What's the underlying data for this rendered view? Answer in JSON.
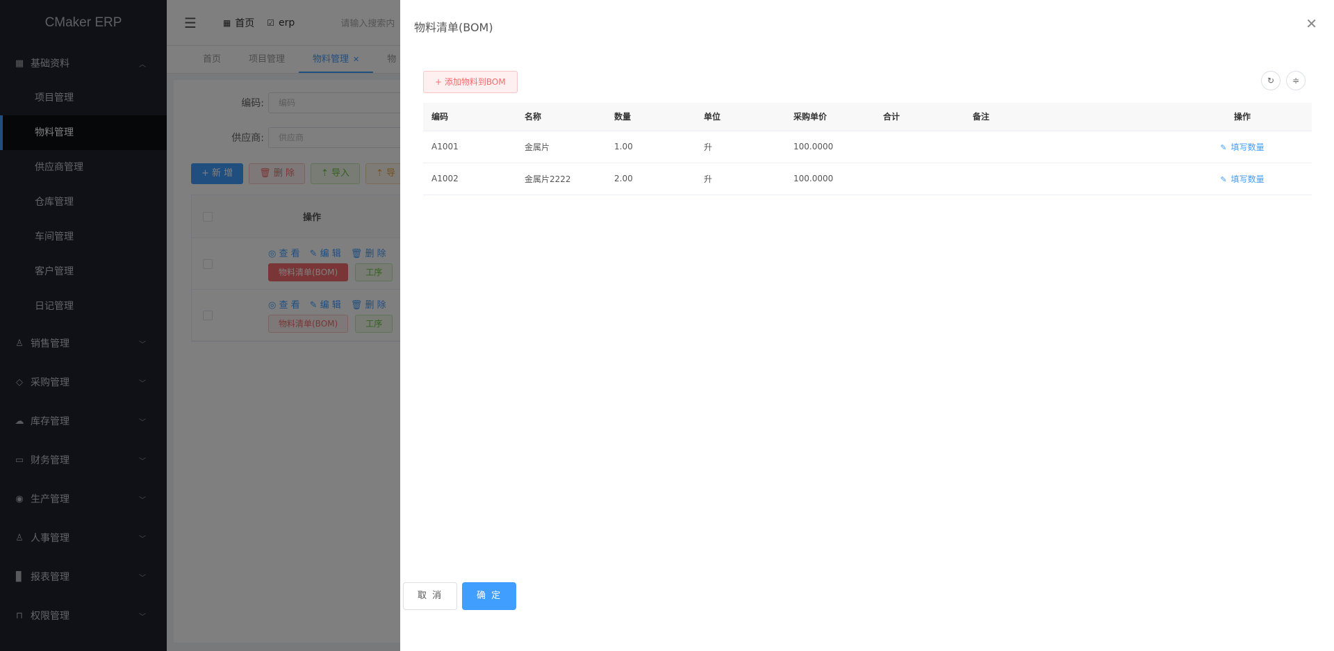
{
  "app": {
    "title": "CMaker ERP"
  },
  "sidebar": {
    "groups": [
      {
        "label": "基础资料",
        "icon": "grid-icon",
        "expanded": true,
        "items": [
          {
            "label": "项目管理"
          },
          {
            "label": "物料管理",
            "active": true
          },
          {
            "label": "供应商管理"
          },
          {
            "label": "仓库管理"
          },
          {
            "label": "车间管理"
          },
          {
            "label": "客户管理"
          },
          {
            "label": "日记管理"
          }
        ]
      },
      {
        "label": "销售管理",
        "icon": "user-icon"
      },
      {
        "label": "采购管理",
        "icon": "tag-icon"
      },
      {
        "label": "库存管理",
        "icon": "cloud-icon"
      },
      {
        "label": "财务管理",
        "icon": "wallet-icon"
      },
      {
        "label": "生产管理",
        "icon": "location-icon"
      },
      {
        "label": "人事管理",
        "icon": "person-icon"
      },
      {
        "label": "报表管理",
        "icon": "bar-chart-icon"
      },
      {
        "label": "权限管理",
        "icon": "lock-icon"
      }
    ]
  },
  "navbar": {
    "breadcrumbs": [
      {
        "label": "首页",
        "icon": "grid-icon"
      },
      {
        "label": "erp",
        "icon": "check-square-icon"
      }
    ],
    "search_placeholder": "请输入搜索内"
  },
  "tabs": [
    {
      "label": "首页"
    },
    {
      "label": "项目管理"
    },
    {
      "label": "物料管理",
      "active": true
    },
    {
      "label": "物"
    }
  ],
  "filter": {
    "code_label": "编码:",
    "code_placeholder": "编码",
    "supplier_label": "供应商:",
    "supplier_placeholder": "供应商"
  },
  "toolbar": {
    "add": "+ 新 增",
    "delete": "删 除",
    "import": "导入",
    "export": "导"
  },
  "grid": {
    "op_header": "操作",
    "links": {
      "view": "查 看",
      "edit": "编 辑",
      "delete": "删 除"
    },
    "bom_button": "物料清单(BOM)",
    "step_button": "工序"
  },
  "drawer": {
    "title": "物料清单(BOM)",
    "add_button": "添加物料到BOM",
    "columns": [
      "编码",
      "名称",
      "数量",
      "单位",
      "采购单价",
      "合计",
      "备注",
      "操作"
    ],
    "rows": [
      {
        "code": "A1001",
        "name": "金属片",
        "qty": "1.00",
        "unit": "升",
        "price": "100.0000",
        "total": "",
        "note": "",
        "action": "填写数量"
      },
      {
        "code": "A1002",
        "name": "金属片2222",
        "qty": "2.00",
        "unit": "升",
        "price": "100.0000",
        "total": "",
        "note": "",
        "action": "填写数量"
      }
    ],
    "cancel_button": "取 消",
    "confirm_button": "确 定"
  },
  "colors": {
    "primary": "#409eff",
    "danger": "#f56c6c",
    "success": "#67c23a",
    "sidebar_bg": "#1f232d"
  }
}
